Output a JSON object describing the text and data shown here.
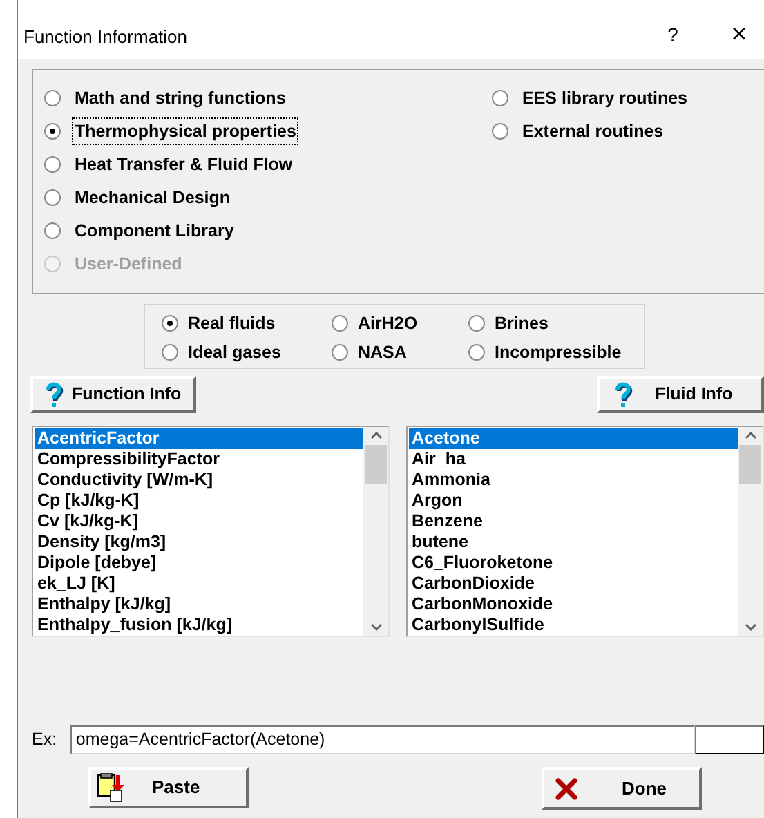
{
  "window": {
    "title": "Function Information",
    "help_button": "?",
    "close_button": "×"
  },
  "categories": {
    "column_1": [
      {
        "label": "Math and string functions",
        "selected": false,
        "disabled": false
      },
      {
        "label": "Thermophysical properties",
        "selected": true,
        "disabled": false
      },
      {
        "label": "Heat Transfer & Fluid Flow",
        "selected": false,
        "disabled": false
      },
      {
        "label": "Mechanical Design",
        "selected": false,
        "disabled": false
      },
      {
        "label": "Component Library",
        "selected": false,
        "disabled": false
      },
      {
        "label": "User-Defined",
        "selected": false,
        "disabled": true
      }
    ],
    "column_2": [
      {
        "label": "EES library routines",
        "selected": false,
        "disabled": false
      },
      {
        "label": "External routines",
        "selected": false,
        "disabled": false
      }
    ]
  },
  "fluid_types": [
    {
      "label": "Real fluids",
      "selected": true
    },
    {
      "label": "AirH2O",
      "selected": false
    },
    {
      "label": "Brines",
      "selected": false
    },
    {
      "label": "Ideal gases",
      "selected": false
    },
    {
      "label": "NASA",
      "selected": false
    },
    {
      "label": "Incompressible",
      "selected": false
    }
  ],
  "function_info_button": "Function Info",
  "fluid_info_button": "Fluid Info",
  "functions": [
    {
      "label": "AcentricFactor",
      "selected": true
    },
    {
      "label": "CompressibilityFactor",
      "selected": false
    },
    {
      "label": "Conductivity [W/m-K]",
      "selected": false
    },
    {
      "label": "Cp [kJ/kg-K]",
      "selected": false
    },
    {
      "label": "Cv [kJ/kg-K]",
      "selected": false
    },
    {
      "label": "Density [kg/m3]",
      "selected": false
    },
    {
      "label": "Dipole [debye]",
      "selected": false
    },
    {
      "label": "ek_LJ [K]",
      "selected": false
    },
    {
      "label": "Enthalpy [kJ/kg]",
      "selected": false
    },
    {
      "label": "Enthalpy_fusion [kJ/kg]",
      "selected": false
    }
  ],
  "fluids": [
    {
      "label": "Acetone",
      "selected": true
    },
    {
      "label": "Air_ha",
      "selected": false
    },
    {
      "label": "Ammonia",
      "selected": false
    },
    {
      "label": "Argon",
      "selected": false
    },
    {
      "label": "Benzene",
      "selected": false
    },
    {
      "label": "butene",
      "selected": false
    },
    {
      "label": "C6_Fluoroketone",
      "selected": false
    },
    {
      "label": "CarbonDioxide",
      "selected": false
    },
    {
      "label": "CarbonMonoxide",
      "selected": false
    },
    {
      "label": "CarbonylSulfide",
      "selected": false
    }
  ],
  "example": {
    "label": "Ex:",
    "value": "omega=AcentricFactor(Acetone)"
  },
  "paste_button": "Paste",
  "done_button": "Done"
}
